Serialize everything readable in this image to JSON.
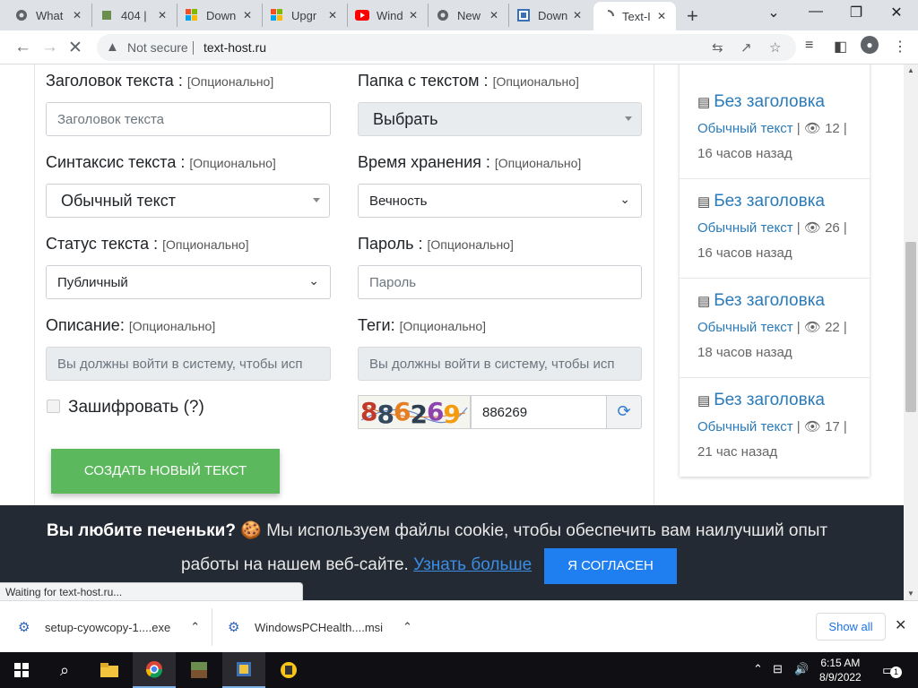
{
  "browser": {
    "tabs": [
      {
        "label": "What",
        "icon": "chrome-icon"
      },
      {
        "label": "404 |",
        "icon": "cube-icon"
      },
      {
        "label": "Down",
        "icon": "microsoft-icon"
      },
      {
        "label": "Upgr",
        "icon": "microsoft-icon"
      },
      {
        "label": "Wind",
        "icon": "youtube-icon"
      },
      {
        "label": "New",
        "icon": "chrome-icon"
      },
      {
        "label": "Down",
        "icon": "windows-app-icon"
      },
      {
        "label": "Text-I",
        "icon": "loading-spinner-icon",
        "active": true
      }
    ],
    "security_label": "Not secure",
    "url": "text-host.ru"
  },
  "form": {
    "title_label": "Заголовок текста :",
    "title_placeholder": "Заголовок текста",
    "folder_label": "Папка с текстом :",
    "folder_value": "Выбрать",
    "syntax_label": "Синтаксис текста :",
    "syntax_value": "Обычный текст",
    "expiry_label": "Время хранения :",
    "expiry_value": "Вечность",
    "status_label": "Статус текста :",
    "status_value": "Публичный",
    "password_label": "Пароль :",
    "password_placeholder": "Пароль",
    "description_label": "Описание:",
    "description_placeholder": "Вы должны войти в систему, чтобы исп",
    "tags_label": "Теги:",
    "tags_placeholder": "Вы должны войти в систему, чтобы исп",
    "optional": "[Опционально]",
    "encrypt_label": "Зашифровать",
    "encrypt_help": "(?)",
    "captcha_image_text": "886269",
    "captcha_value": "886269",
    "create_button": "СОЗДАТЬ НОВЫЙ ТЕКСТ"
  },
  "recent": [
    {
      "title": "Без заголовка",
      "syntax": "Обычный текст",
      "views": "12",
      "time": "16 часов назад"
    },
    {
      "title": "Без заголовка",
      "syntax": "Обычный текст",
      "views": "26",
      "time": "16 часов назад"
    },
    {
      "title": "Без заголовка",
      "syntax": "Обычный текст",
      "views": "22",
      "time": "18 часов назад"
    },
    {
      "title": "Без заголовка",
      "syntax": "Обычный текст",
      "views": "17",
      "time": "21 час назад"
    }
  ],
  "cookie": {
    "heading": "Вы любите печеньки?",
    "text1": "Мы используем файлы cookie, чтобы обеспечить вам наилучший опыт",
    "text2": "работы на нашем веб-сайте.",
    "learn_more": "Узнать больше",
    "agree_button": "Я СОГЛАСЕН"
  },
  "status_text": "Waiting for text-host.ru...",
  "downloads": {
    "items": [
      {
        "name": "setup-cyowcopy-1....exe"
      },
      {
        "name": "WindowsPCHealth....msi"
      }
    ],
    "show_all": "Show all"
  },
  "taskbar": {
    "time": "6:15 AM",
    "date": "8/9/2022",
    "notifications": "1"
  }
}
